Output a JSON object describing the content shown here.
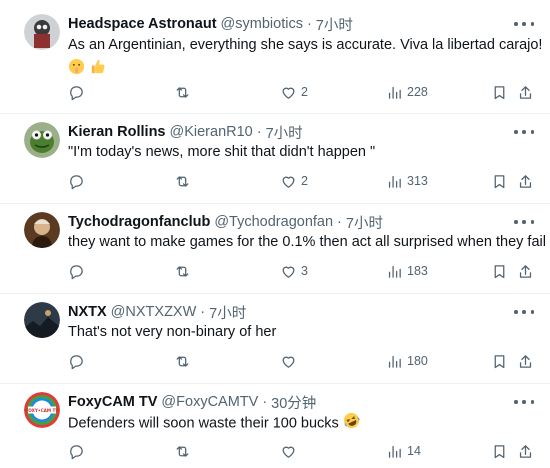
{
  "tweets": [
    {
      "name": "Headspace Astronaut",
      "handle": "@symbiotics",
      "time": "7小时",
      "text": "As an Argentinian, everything she says is accurate. Viva la libertad carajo!",
      "emojis": [
        "shushing-face",
        "thumbs-up"
      ],
      "replies": "",
      "retweets": "",
      "likes": "2",
      "views": "228"
    },
    {
      "name": "Kieran Rollins",
      "handle": "@KieranR10",
      "time": "7小时",
      "text": "\"I'm today's news, more shit that didn't happen \"",
      "replies": "",
      "retweets": "",
      "likes": "2",
      "views": "313"
    },
    {
      "name": "Tychodragonfanclub",
      "handle": "@Tychodragonfan",
      "time": "7小时",
      "text": "they want to make games for the 0.1% then act all surprised when they fail",
      "replies": "",
      "retweets": "",
      "likes": "3",
      "views": "183"
    },
    {
      "name": "NXTX",
      "handle": "@NXTXZXW",
      "time": "7小时",
      "text": "That's not very non-binary of her",
      "replies": "",
      "retweets": "",
      "likes": "",
      "views": "180"
    },
    {
      "name": "FoxyCAM TV",
      "handle": "@FoxyCAMTV",
      "time": "30分钟",
      "text": "Defenders will soon waste their 100 bucks",
      "emojis": [
        "rolling-on-floor-laughing"
      ],
      "avatar_text": "FOXY•CAM TV",
      "replies": "",
      "retweets": "",
      "likes": "",
      "views": "14"
    }
  ],
  "separator": "·",
  "colors": {
    "text": "#0f1419",
    "muted": "#536471",
    "divider": "#eff3f4"
  }
}
